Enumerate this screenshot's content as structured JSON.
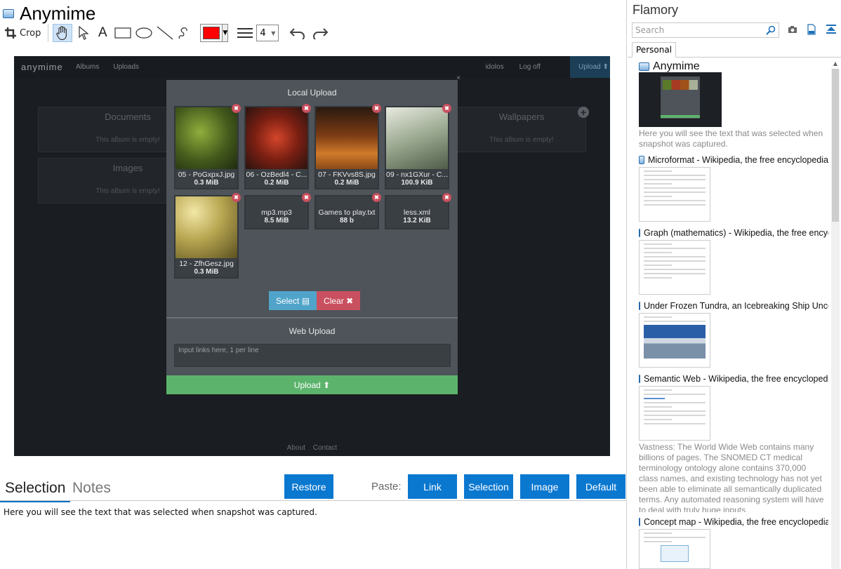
{
  "app": {
    "title": "Anymime"
  },
  "toolbar": {
    "crop_label": "Crop",
    "line_width": "4",
    "stroke_color": "#ff0000"
  },
  "screenshot": {
    "brand": "anymime",
    "nav": [
      "Albums",
      "Uploads"
    ],
    "nav_right": [
      "idolos",
      "Log off"
    ],
    "nav_upload": "Upload",
    "albums": [
      {
        "title": "Documents",
        "empty": "This album is empty!"
      },
      {
        "title": "Wallpapers",
        "empty": "This album is empty!"
      },
      {
        "title": "Images",
        "empty": "This album is empty!"
      }
    ],
    "footer": [
      "About",
      "Contact"
    ],
    "modal": {
      "close": "×",
      "local_title": "Local Upload",
      "files": [
        {
          "name": "05 - PoGxpxJ.jpg",
          "size": "0.3 MiB"
        },
        {
          "name": "06 - OzBedl4 - C...",
          "size": "0.2 MiB"
        },
        {
          "name": "07 - FKVvs8S.jpg",
          "size": "0.2 MiB"
        },
        {
          "name": "09 - nx1GXur - C...",
          "size": "100.9 KiB"
        },
        {
          "name": "12 - ZfhGesz.jpg",
          "size": "0.3 MiB"
        },
        {
          "name": "mp3.mp3",
          "size": "8.5 MiB"
        },
        {
          "name": "Games to play.txt",
          "size": "88 b"
        },
        {
          "name": "less.xml",
          "size": "13.2 KiB"
        }
      ],
      "select_label": "Select",
      "clear_label": "Clear",
      "web_title": "Web Upload",
      "links_placeholder": "Input links here, 1 per line",
      "upload_label": "Upload"
    }
  },
  "bottom": {
    "tabs": [
      "Selection",
      "Notes"
    ],
    "restore": "Restore",
    "paste_label": "Paste:",
    "paste_buttons": [
      "Link",
      "Selection",
      "Image",
      "Default"
    ],
    "selection_text": "Here you will see the text that was selected when snapshot was captured."
  },
  "sidebar": {
    "title": "Flamory",
    "search_placeholder": "Search",
    "tab": "Personal",
    "entries": [
      {
        "title": "Anymime",
        "text": "Here you will see the text that was selected when snapshot was captured."
      },
      {
        "title": "Microformat - Wikipedia, the free encyclopedia"
      },
      {
        "title": "Graph (mathematics) - Wikipedia, the free encyclopedia"
      },
      {
        "title": "Under Frozen Tundra, an Icebreaking Ship Uncovers"
      },
      {
        "title": "Semantic Web - Wikipedia, the free encyclopedia",
        "text": "Vastness: The World Wide Web contains many billions of pages. The SNOMED CT medical terminology ontology alone contains 370,000 class names, and existing technology has not yet been able to eliminate all semantically duplicated terms. Any automated reasoning system will have to deal with truly huge inputs."
      },
      {
        "title": "Concept map - Wikipedia, the free encyclopedia"
      }
    ]
  }
}
